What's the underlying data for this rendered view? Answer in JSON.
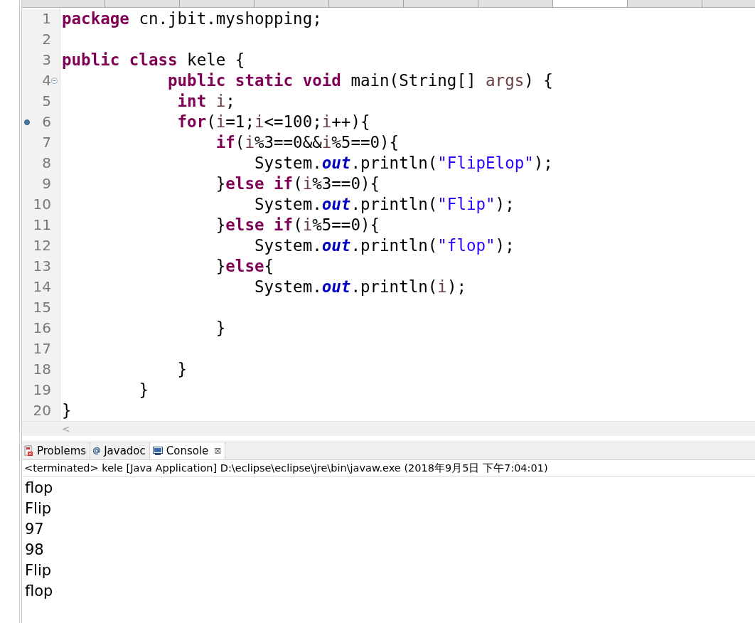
{
  "editor_tabs": [
    {
      "selected": false
    },
    {
      "selected": false
    },
    {
      "selected": false
    },
    {
      "selected": false
    },
    {
      "selected": false
    },
    {
      "selected": false
    },
    {
      "selected": false
    },
    {
      "selected": true
    },
    {
      "selected": false
    }
  ],
  "code_lines": [
    {
      "number": "1",
      "bookmark": false,
      "collapse_marker": false,
      "tokens": [
        {
          "kind": "keyword",
          "text": "package"
        },
        {
          "kind": "plain",
          "text": " cn.jbit.myshopping;"
        }
      ]
    },
    {
      "number": "2",
      "bookmark": false,
      "collapse_marker": false
    },
    {
      "number": "3",
      "bookmark": false,
      "collapse_marker": false,
      "tokens": [
        {
          "kind": "keyword",
          "text": "public class"
        },
        {
          "kind": "plain",
          "text": " kele {"
        }
      ]
    },
    {
      "number": "4",
      "bookmark": false,
      "collapse_marker": true,
      "tokens": [
        {
          "kind": "keyword",
          "text": "           public static void"
        },
        {
          "kind": "plain",
          "text": " main(String[] "
        },
        {
          "kind": "variable",
          "text": "args"
        },
        {
          "kind": "plain",
          "text": ") {"
        }
      ]
    },
    {
      "number": "5",
      "bookmark": false,
      "collapse_marker": false,
      "tokens": [
        {
          "kind": "keyword",
          "text": "            int"
        },
        {
          "kind": "variable",
          "text": " i"
        },
        {
          "kind": "plain",
          "text": ";"
        }
      ]
    },
    {
      "number": "6",
      "bookmark": true,
      "collapse_marker": false,
      "tokens": [
        {
          "kind": "keyword",
          "text": "            for"
        },
        {
          "kind": "plain",
          "text": "("
        },
        {
          "kind": "variable",
          "text": "i"
        },
        {
          "kind": "plain",
          "text": "=1;"
        },
        {
          "kind": "variable",
          "text": "i"
        },
        {
          "kind": "plain",
          "text": "<=100;"
        },
        {
          "kind": "variable",
          "text": "i"
        },
        {
          "kind": "plain",
          "text": "++){"
        }
      ]
    },
    {
      "number": "7",
      "bookmark": false,
      "collapse_marker": false,
      "tokens": [
        {
          "kind": "keyword",
          "text": "                if"
        },
        {
          "kind": "plain",
          "text": "("
        },
        {
          "kind": "variable",
          "text": "i"
        },
        {
          "kind": "plain",
          "text": "%3==0&&"
        },
        {
          "kind": "variable",
          "text": "i"
        },
        {
          "kind": "plain",
          "text": "%5==0){"
        }
      ]
    },
    {
      "number": "8",
      "bookmark": false,
      "collapse_marker": false,
      "tokens": [
        {
          "kind": "plain",
          "text": "                    System."
        },
        {
          "kind": "field",
          "text": "out"
        },
        {
          "kind": "plain",
          "text": ".println("
        },
        {
          "kind": "string",
          "text": "\"FlipElop\""
        },
        {
          "kind": "plain",
          "text": ");"
        }
      ]
    },
    {
      "number": "9",
      "bookmark": false,
      "collapse_marker": false,
      "tokens": [
        {
          "kind": "plain",
          "text": "                }"
        },
        {
          "kind": "keyword",
          "text": "else if"
        },
        {
          "kind": "plain",
          "text": "("
        },
        {
          "kind": "variable",
          "text": "i"
        },
        {
          "kind": "plain",
          "text": "%3==0){"
        }
      ]
    },
    {
      "number": "10",
      "bookmark": false,
      "collapse_marker": false,
      "tokens": [
        {
          "kind": "plain",
          "text": "                    System."
        },
        {
          "kind": "field",
          "text": "out"
        },
        {
          "kind": "plain",
          "text": ".println("
        },
        {
          "kind": "string",
          "text": "\"Flip\""
        },
        {
          "kind": "plain",
          "text": ");"
        }
      ]
    },
    {
      "number": "11",
      "bookmark": false,
      "collapse_marker": false,
      "tokens": [
        {
          "kind": "plain",
          "text": "                }"
        },
        {
          "kind": "keyword",
          "text": "else if"
        },
        {
          "kind": "plain",
          "text": "("
        },
        {
          "kind": "variable",
          "text": "i"
        },
        {
          "kind": "plain",
          "text": "%5==0){"
        }
      ]
    },
    {
      "number": "12",
      "bookmark": false,
      "collapse_marker": false,
      "tokens": [
        {
          "kind": "plain",
          "text": "                    System."
        },
        {
          "kind": "field",
          "text": "out"
        },
        {
          "kind": "plain",
          "text": ".println("
        },
        {
          "kind": "string",
          "text": "\"flop\""
        },
        {
          "kind": "plain",
          "text": ");"
        }
      ]
    },
    {
      "number": "13",
      "bookmark": false,
      "collapse_marker": false,
      "tokens": [
        {
          "kind": "plain",
          "text": "                }"
        },
        {
          "kind": "keyword",
          "text": "else"
        },
        {
          "kind": "plain",
          "text": "{"
        }
      ]
    },
    {
      "number": "14",
      "bookmark": false,
      "collapse_marker": false,
      "tokens": [
        {
          "kind": "plain",
          "text": "                    System."
        },
        {
          "kind": "field",
          "text": "out"
        },
        {
          "kind": "plain",
          "text": ".println("
        },
        {
          "kind": "variable",
          "text": "i"
        },
        {
          "kind": "plain",
          "text": ");"
        }
      ]
    },
    {
      "number": "15",
      "bookmark": false,
      "collapse_marker": false
    },
    {
      "number": "16",
      "bookmark": false,
      "collapse_marker": false,
      "tokens": [
        {
          "kind": "plain",
          "text": "                }"
        }
      ]
    },
    {
      "number": "17",
      "bookmark": false,
      "collapse_marker": false
    },
    {
      "number": "18",
      "bookmark": false,
      "collapse_marker": false,
      "tokens": [
        {
          "kind": "plain",
          "text": "            }"
        }
      ]
    },
    {
      "number": "19",
      "bookmark": false,
      "collapse_marker": false,
      "tokens": [
        {
          "kind": "plain",
          "text": "        }"
        }
      ]
    },
    {
      "number": "20",
      "bookmark": false,
      "collapse_marker": false,
      "tokens": [
        {
          "kind": "plain",
          "text": "}"
        }
      ]
    }
  ],
  "scroll_arrow": "<",
  "views": [
    {
      "label": "Problems",
      "kind": "problems",
      "selected": false
    },
    {
      "label": "Javadoc",
      "kind": "javadoc",
      "selected": false
    },
    {
      "label": "Console",
      "kind": "console",
      "selected": true,
      "close": "⊠"
    }
  ],
  "console": {
    "status": "<terminated> kele [Java Application] D:\\eclipse\\eclipse\\jre\\bin\\javaw.exe (2018年9月5日 下午7:04:01)",
    "output": [
      "flop",
      "Flip",
      "97",
      "98",
      "Flip",
      "flop"
    ]
  }
}
